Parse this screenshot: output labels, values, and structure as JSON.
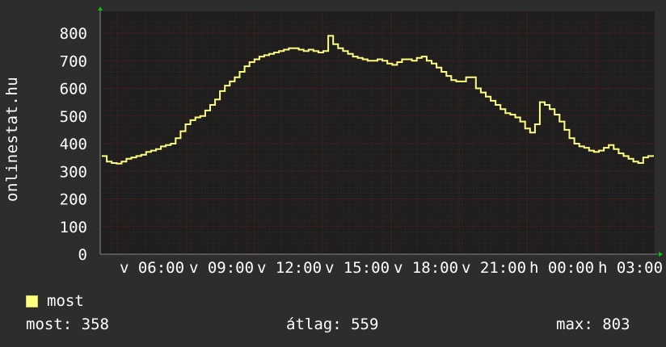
{
  "side_label": "onlinestat.hu",
  "legend": {
    "label": "most"
  },
  "stats": {
    "now": "most: 358",
    "avg": "átlag: 559",
    "max": "max: 803"
  },
  "colors": {
    "background": "#2d2d2d",
    "plot_background": "#1e1e1e",
    "line": "#ffff80",
    "grid_major": "#5a1e1e",
    "grid_minor": "#3a2828",
    "axis_arrow": "#00cc00"
  },
  "chart_data": {
    "type": "line",
    "title": "",
    "xlabel": "",
    "ylabel": "",
    "ylim": [
      0,
      850
    ],
    "yticks": [
      0,
      100,
      200,
      300,
      400,
      500,
      600,
      700,
      800
    ],
    "xticks": [
      "v 06:00",
      "v 09:00",
      "v 12:00",
      "v 15:00",
      "v 18:00",
      "v 21:00",
      "h 00:00",
      "h 03:00"
    ],
    "grid": true,
    "series": [
      {
        "name": "most",
        "values": [
          355,
          335,
          330,
          328,
          335,
          345,
          350,
          355,
          360,
          370,
          375,
          380,
          390,
          395,
          400,
          420,
          445,
          470,
          485,
          495,
          500,
          520,
          540,
          560,
          590,
          610,
          625,
          640,
          660,
          680,
          695,
          705,
          715,
          720,
          725,
          730,
          735,
          740,
          745,
          745,
          740,
          735,
          740,
          735,
          730,
          735,
          790,
          760,
          745,
          735,
          725,
          715,
          710,
          705,
          700,
          700,
          705,
          700,
          690,
          685,
          695,
          705,
          705,
          700,
          710,
          715,
          700,
          690,
          675,
          660,
          645,
          630,
          625,
          625,
          640,
          640,
          600,
          585,
          570,
          555,
          540,
          525,
          510,
          505,
          495,
          480,
          455,
          440,
          470,
          550,
          540,
          525,
          505,
          480,
          450,
          420,
          400,
          390,
          385,
          375,
          370,
          375,
          385,
          395,
          380,
          365,
          355,
          345,
          335,
          330,
          350,
          355,
          358
        ]
      }
    ]
  }
}
